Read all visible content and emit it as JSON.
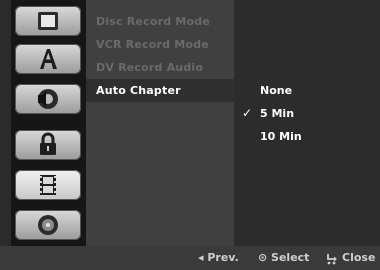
{
  "sidebar": {
    "icons": [
      {
        "name": "disc-icon"
      },
      {
        "name": "language-a-icon"
      },
      {
        "name": "audio-speaker-icon"
      },
      {
        "name": "lock-icon"
      },
      {
        "name": "film-record-icon"
      },
      {
        "name": "disc-settings-icon"
      }
    ]
  },
  "menu": {
    "items": [
      {
        "label": "Disc Record Mode",
        "state": "disabled"
      },
      {
        "label": "VCR Record Mode",
        "state": "disabled"
      },
      {
        "label": "DV Record Audio",
        "state": "disabled"
      },
      {
        "label": "Auto Chapter",
        "state": "selected"
      }
    ]
  },
  "options": {
    "items": [
      "None",
      "5 Min",
      "10 Min"
    ],
    "checked": "5 Min",
    "check_glyph": "✓"
  },
  "footer": {
    "prev": "◂ Prev.",
    "select": "⊙ Select",
    "close": "Close"
  }
}
